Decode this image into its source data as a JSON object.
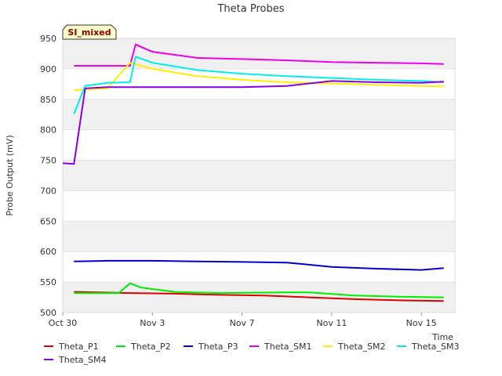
{
  "chart_data": {
    "type": "line",
    "title": "Theta Probes",
    "ylabel": "Probe Output (mV)",
    "xlabel": "Time",
    "annotation": "SI_mixed",
    "grid": true,
    "legend_position": "bottom",
    "xlim": [
      "2023-10-30",
      "2023-11-16T12:00"
    ],
    "ylim": [
      500,
      950
    ],
    "x_tick_labels": [
      "Oct 30",
      "Nov 3",
      "Nov 7",
      "Nov 11",
      "Nov 15"
    ],
    "x_ticks": [
      "2023-10-30",
      "2023-11-03",
      "2023-11-07",
      "2023-11-11",
      "2023-11-15"
    ],
    "y_ticks": [
      500,
      550,
      600,
      650,
      700,
      750,
      800,
      850,
      900,
      950
    ],
    "series": [
      {
        "name": "Theta_P1",
        "color": "#dd0000",
        "x": [
          "2023-10-30T12:00",
          "2023-11-02",
          "2023-11-04",
          "2023-11-06",
          "2023-11-08",
          "2023-11-10",
          "2023-11-12",
          "2023-11-14",
          "2023-11-16"
        ],
        "y": [
          534,
          532,
          531,
          529,
          528,
          525,
          522,
          520,
          519
        ]
      },
      {
        "name": "Theta_P2",
        "color": "#00ee00",
        "x": [
          "2023-10-30T12:00",
          "2023-11-01T12:00",
          "2023-11-02",
          "2023-11-02T12:00",
          "2023-11-04",
          "2023-11-06",
          "2023-11-09",
          "2023-11-10",
          "2023-11-12",
          "2023-11-14",
          "2023-11-16"
        ],
        "y": [
          532,
          532,
          548,
          541,
          534,
          532,
          533,
          533,
          528,
          526,
          525
        ]
      },
      {
        "name": "Theta_P3",
        "color": "#0000cc",
        "x": [
          "2023-10-30T12:00",
          "2023-11-01",
          "2023-11-03",
          "2023-11-05",
          "2023-11-07",
          "2023-11-09",
          "2023-11-11",
          "2023-11-13",
          "2023-11-15",
          "2023-11-16"
        ],
        "y": [
          584,
          585,
          585,
          584,
          583,
          582,
          575,
          572,
          570,
          573
        ]
      },
      {
        "name": "Theta_SM1",
        "color": "#ee00ee",
        "x": [
          "2023-10-30T12:00",
          "2023-11-02",
          "2023-11-02T06:00",
          "2023-11-03",
          "2023-11-05",
          "2023-11-07",
          "2023-11-09",
          "2023-11-11",
          "2023-11-13",
          "2023-11-15",
          "2023-11-16"
        ],
        "y": [
          905,
          905,
          940,
          928,
          918,
          916,
          914,
          911,
          910,
          909,
          908
        ]
      },
      {
        "name": "Theta_SM2",
        "color": "#ffee00",
        "x": [
          "2023-10-30T12:00",
          "2023-11-01",
          "2023-11-02",
          "2023-11-03",
          "2023-11-05",
          "2023-11-07",
          "2023-11-09",
          "2023-11-11",
          "2023-11-13",
          "2023-11-15",
          "2023-11-16"
        ],
        "y": [
          865,
          868,
          910,
          900,
          888,
          882,
          878,
          876,
          874,
          872,
          871
        ]
      },
      {
        "name": "Theta_SM3",
        "color": "#00eeee",
        "x": [
          "2023-10-30T12:00",
          "2023-10-31",
          "2023-11-01",
          "2023-11-02",
          "2023-11-02T06:00",
          "2023-11-03",
          "2023-11-05",
          "2023-11-07",
          "2023-11-09",
          "2023-11-11",
          "2023-11-13",
          "2023-11-15",
          "2023-11-16"
        ],
        "y": [
          826,
          872,
          877,
          878,
          920,
          910,
          898,
          892,
          888,
          885,
          882,
          880,
          878
        ]
      },
      {
        "name": "Theta_SM4",
        "color": "#8800dd",
        "x": [
          "2023-10-30",
          "2023-10-30T12:00",
          "2023-10-31",
          "2023-11-01",
          "2023-11-03",
          "2023-11-05",
          "2023-11-07",
          "2023-11-09",
          "2023-11-11",
          "2023-11-13",
          "2023-11-15",
          "2023-11-16"
        ],
        "y": [
          745,
          744,
          868,
          870,
          870,
          870,
          870,
          872,
          880,
          878,
          877,
          879
        ]
      }
    ]
  }
}
